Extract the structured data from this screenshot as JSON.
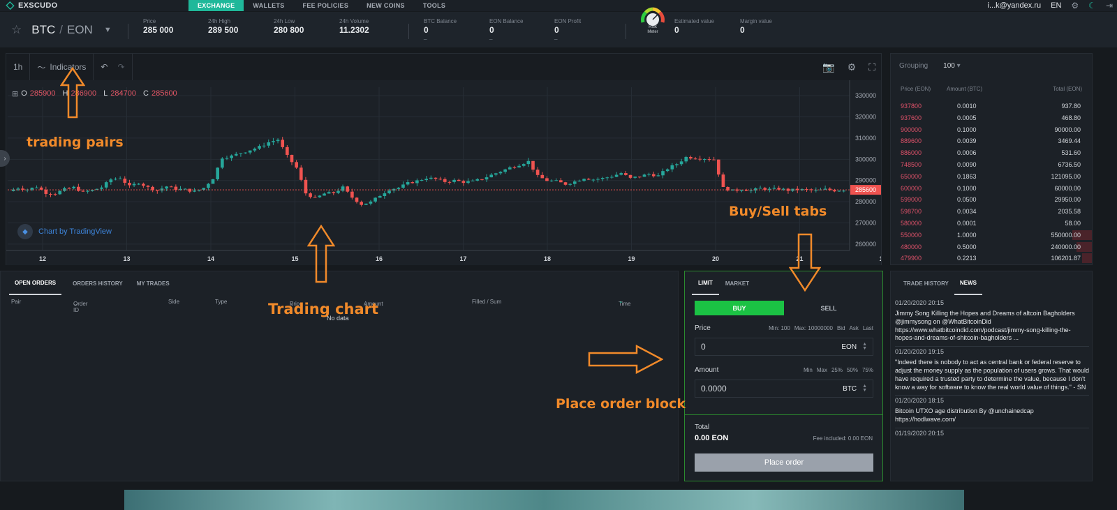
{
  "nav": {
    "logo": "EXSCUDO",
    "tabs": [
      "EXCHANGE",
      "WALLETS",
      "FEE POLICIES",
      "NEW COINS",
      "TOOLS"
    ],
    "user": "i...k@yandex.ru",
    "lang": "EN"
  },
  "ticker": {
    "base": "BTC",
    "quote": "EON",
    "stats": [
      {
        "label": "Price",
        "value": "285 000"
      },
      {
        "label": "24h High",
        "value": "289 500"
      },
      {
        "label": "24h Low",
        "value": "280 800"
      },
      {
        "label": "24h Volume",
        "value": "11.2302"
      },
      {
        "label": "BTC Balance",
        "value": "0"
      },
      {
        "label": "EON Balance",
        "value": "0"
      },
      {
        "label": "EON Profit",
        "value": "0"
      },
      {
        "label": "Estimated value",
        "value": "0"
      },
      {
        "label": "Margin value",
        "value": "0"
      }
    ],
    "gauge_label_1": "Risk",
    "gauge_label_2": "Meter"
  },
  "chart": {
    "interval": "1h",
    "indicators": "Indicators",
    "ohlc": {
      "o_label": "O",
      "o": "285900",
      "h_label": "H",
      "h": "286900",
      "l_label": "L",
      "l": "284700",
      "c_label": "C",
      "c": "285600"
    },
    "badge": "Chart by TradingView",
    "last_price_tag": "285600"
  },
  "chart_data": {
    "type": "candlestick",
    "y_ticks": [
      "330000",
      "320000",
      "310000",
      "300000",
      "290000",
      "280000",
      "270000",
      "260000"
    ],
    "ylim": [
      257000,
      334000
    ],
    "x_ticks": [
      "12",
      "13",
      "14",
      "15",
      "16",
      "17",
      "18",
      "19",
      "20",
      "21",
      "15:"
    ],
    "last_price": 285600,
    "close_path": [
      285000,
      286500,
      285800,
      287000,
      284200,
      283900,
      285800,
      286700,
      284500,
      285400,
      286800,
      290500,
      291200,
      287200,
      289000,
      286700,
      285300,
      287200,
      286000,
      285700,
      284800,
      286500,
      291000,
      300800,
      301500,
      303000,
      304400,
      305800,
      308000,
      309300,
      301500,
      296000,
      284000,
      281500,
      283800,
      284200,
      286700,
      282000,
      278800,
      279800,
      283000,
      285800,
      286600,
      288700,
      289800,
      291200,
      290700,
      289500,
      290000,
      289300,
      289500,
      290800,
      292600,
      294300,
      296000,
      297500,
      299000,
      292000,
      290000,
      289600,
      288300,
      289500,
      291200,
      290500,
      291000,
      292000,
      293500,
      291000,
      292000,
      293000,
      292200,
      295600,
      297800,
      301000,
      300700,
      300400,
      300000,
      286500,
      285200,
      285800,
      285200,
      286300,
      285800,
      286100,
      285400,
      285700,
      285600,
      285200,
      285800,
      285300,
      285600
    ]
  },
  "orderbook": {
    "grouping_label": "Grouping",
    "grouping_value": "100",
    "cols": [
      "Price (EON)",
      "Amount (BTC)",
      "Total (EON)"
    ],
    "rows": [
      {
        "price": "937800",
        "amount": "0.0010",
        "total": "937.80",
        "depth": 0
      },
      {
        "price": "937600",
        "amount": "0.0005",
        "total": "468.80",
        "depth": 0
      },
      {
        "price": "900000",
        "amount": "0.1000",
        "total": "90000.00",
        "depth": 0
      },
      {
        "price": "889600",
        "amount": "0.0039",
        "total": "3469.44",
        "depth": 0
      },
      {
        "price": "886000",
        "amount": "0.0006",
        "total": "531.60",
        "depth": 0
      },
      {
        "price": "748500",
        "amount": "0.0090",
        "total": "6736.50",
        "depth": 0
      },
      {
        "price": "650000",
        "amount": "0.1863",
        "total": "121095.00",
        "depth": 0
      },
      {
        "price": "600000",
        "amount": "0.1000",
        "total": "60000.00",
        "depth": 0
      },
      {
        "price": "599000",
        "amount": "0.0500",
        "total": "29950.00",
        "depth": 0
      },
      {
        "price": "598700",
        "amount": "0.0034",
        "total": "2035.58",
        "depth": 0
      },
      {
        "price": "580000",
        "amount": "0.0001",
        "total": "58.00",
        "depth": 0
      },
      {
        "price": "550000",
        "amount": "1.0000",
        "total": "550000.00",
        "depth": 0.1
      },
      {
        "price": "480000",
        "amount": "0.5000",
        "total": "240000.00",
        "depth": 0.08
      },
      {
        "price": "479900",
        "amount": "0.2213",
        "total": "106201.87",
        "depth": 0.05
      }
    ]
  },
  "orders": {
    "tabs": [
      "OPEN ORDERS",
      "ORDERS HISTORY",
      "MY TRADES"
    ],
    "cols": [
      "Pair",
      "Order ID",
      "Side",
      "Type",
      "Price",
      "Amount",
      "Filled / Sum",
      "Time"
    ],
    "empty": "No data"
  },
  "place": {
    "tabs": [
      "LIMIT",
      "MARKET"
    ],
    "buy": "BUY",
    "sell": "SELL",
    "price_label": "Price",
    "price_hints": [
      "Min: 100",
      "Max: 10000000",
      "Bid",
      "Ask",
      "Last"
    ],
    "price_value": "0",
    "price_unit": "EON",
    "amount_label": "Amount",
    "amount_hints": [
      "Min",
      "Max",
      "25%",
      "50%",
      "75%"
    ],
    "amount_value": "0.0000",
    "amount_unit": "BTC",
    "total_label": "Total",
    "total_value": "0.00 EON",
    "fee": "Fee included: 0.00 EON",
    "button": "Place order"
  },
  "news": {
    "tabs": [
      "TRADE HISTORY",
      "NEWS"
    ],
    "items": [
      {
        "date": "01/20/2020 20:15",
        "text": "Jimmy Song Killing the Hopes and Dreams of altcoin Bagholders @jimmysong on @WhatBitcoinDid https://www.whatbitcoindid.com/podcast/jimmy-song-killing-the-hopes-and-dreams-of-shitcoin-bagholders ..."
      },
      {
        "date": "01/20/2020 19:15",
        "text": "\"Indeed there is nobody to act as central bank or federal reserve to adjust the money supply as the population of users grows. That would have required a trusted party to determine the value, because I don't know a way for software to know the real world value of things.\" - SN"
      },
      {
        "date": "01/20/2020 18:15",
        "text": "Bitcoin UTXO age distribution By @unchainedcap https://hodlwave.com/"
      },
      {
        "date": "01/19/2020 20:15",
        "text": ""
      }
    ]
  },
  "annotations": {
    "trading_pairs": "trading pairs",
    "trading_chart": "Trading chart",
    "buy_sell_tabs": "Buy/Sell tabs",
    "place_order_block": "Place order block"
  },
  "colors": {
    "accent": "#1fb89a",
    "buy": "#1bc244",
    "ask": "#e0526a",
    "annotation": "#f18a2a"
  }
}
